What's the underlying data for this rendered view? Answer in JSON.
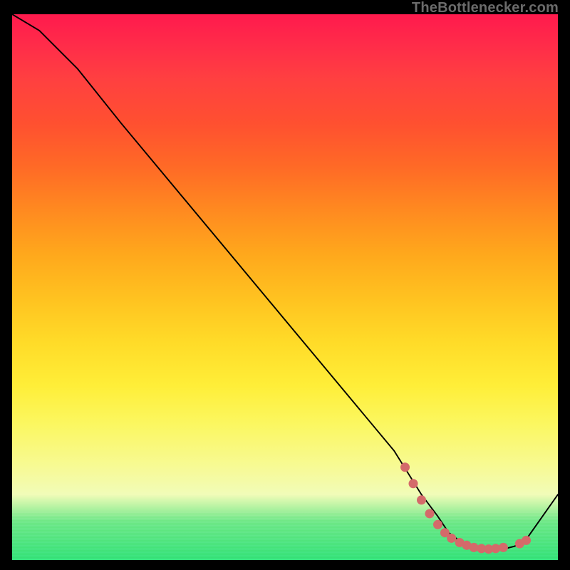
{
  "watermark": "TheBottlenecker.com",
  "chart_data": {
    "type": "line",
    "title": "",
    "xlabel": "",
    "ylabel": "",
    "xlim": [
      0,
      100
    ],
    "ylim": [
      0,
      100
    ],
    "series": [
      {
        "name": "curve",
        "x": [
          0,
          5,
          8,
          12,
          20,
          30,
          40,
          50,
          60,
          70,
          75,
          78,
          80,
          82,
          84,
          86,
          88,
          90,
          92,
          94,
          100
        ],
        "y": [
          100,
          97,
          94,
          90,
          80,
          68,
          56,
          44,
          32,
          20,
          12,
          8,
          5,
          3.5,
          2.5,
          2,
          2,
          2,
          2.5,
          3.5,
          12
        ]
      }
    ],
    "markers": {
      "name": "highlight-dots",
      "color": "#d46a6a",
      "points": [
        {
          "x": 72,
          "y": 17
        },
        {
          "x": 73.5,
          "y": 14
        },
        {
          "x": 75,
          "y": 11
        },
        {
          "x": 76.5,
          "y": 8.5
        },
        {
          "x": 78,
          "y": 6.5
        },
        {
          "x": 79.3,
          "y": 5
        },
        {
          "x": 80.5,
          "y": 4
        },
        {
          "x": 82,
          "y": 3.2
        },
        {
          "x": 83.3,
          "y": 2.7
        },
        {
          "x": 84.6,
          "y": 2.3
        },
        {
          "x": 86,
          "y": 2.1
        },
        {
          "x": 87.3,
          "y": 2.0
        },
        {
          "x": 88.6,
          "y": 2.1
        },
        {
          "x": 90,
          "y": 2.3
        },
        {
          "x": 93,
          "y": 3.0
        },
        {
          "x": 94.2,
          "y": 3.6
        }
      ]
    },
    "background_gradient": {
      "top": "#ff1a4d",
      "mid": "#ffe338",
      "bottom": "#35e27a"
    }
  }
}
